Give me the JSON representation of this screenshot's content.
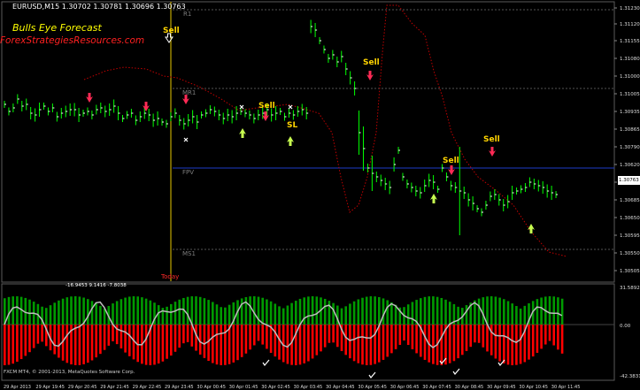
{
  "title": "EURUSD,M15  1.30702 1.30781 1.30696 1.30763",
  "brand": "Bulls Eye Forecast",
  "site": "ForexStrategiesResources.com",
  "levels": {
    "r1": "R1",
    "mr1": "MR1",
    "fpv": "FPV",
    "ms1": "MS1"
  },
  "today_label": "Today",
  "signals": {
    "sell": "Sell",
    "sl": "SL"
  },
  "price_axis": [
    "1.31230",
    "1.31155",
    "1.31080",
    "1.31005",
    "1.30935",
    "1.30865",
    "1.30790",
    "1.30720",
    "1.30650",
    "1.30575",
    "1.30505"
  ],
  "price_axis_extra": [
    "1.31120",
    "1.31000",
    "1.30865",
    "1.30620",
    "1.30763",
    "1.30730",
    "1.30685",
    "1.30595",
    "1.30550",
    "1.30505"
  ],
  "current_price": "1.30763",
  "osc_axis": [
    "31.5892",
    "0.00",
    "-42.3831"
  ],
  "osc_values": "-16.9453  9.1416  -7.8038",
  "time_axis": [
    "29 Apr 2013",
    "29 Apr 19:45",
    "29 Apr 20:45",
    "29 Apr 21:45",
    "29 Apr 22:45",
    "29 Apr 23:45",
    "30 Apr 00:45",
    "30 Apr 01:45",
    "30 Apr 02:45",
    "30 Apr 03:45",
    "30 Apr 04:45",
    "30 Apr 05:45",
    "30 Apr 06:45",
    "30 Apr 07:45",
    "30 Apr 08:45",
    "30 Apr 09:45",
    "30 Apr 10:45",
    "30 Apr 11:45"
  ],
  "footer": "FXCM MT4, © 2001-2013, MetaQuotes Software Corp.",
  "colors": {
    "bull": "#00ff00",
    "bear": "#ff0000",
    "hist_up": "#00aa00",
    "hist_dn": "#ff0000",
    "line": "#c0c0c0",
    "signal": "#ffd400"
  }
}
